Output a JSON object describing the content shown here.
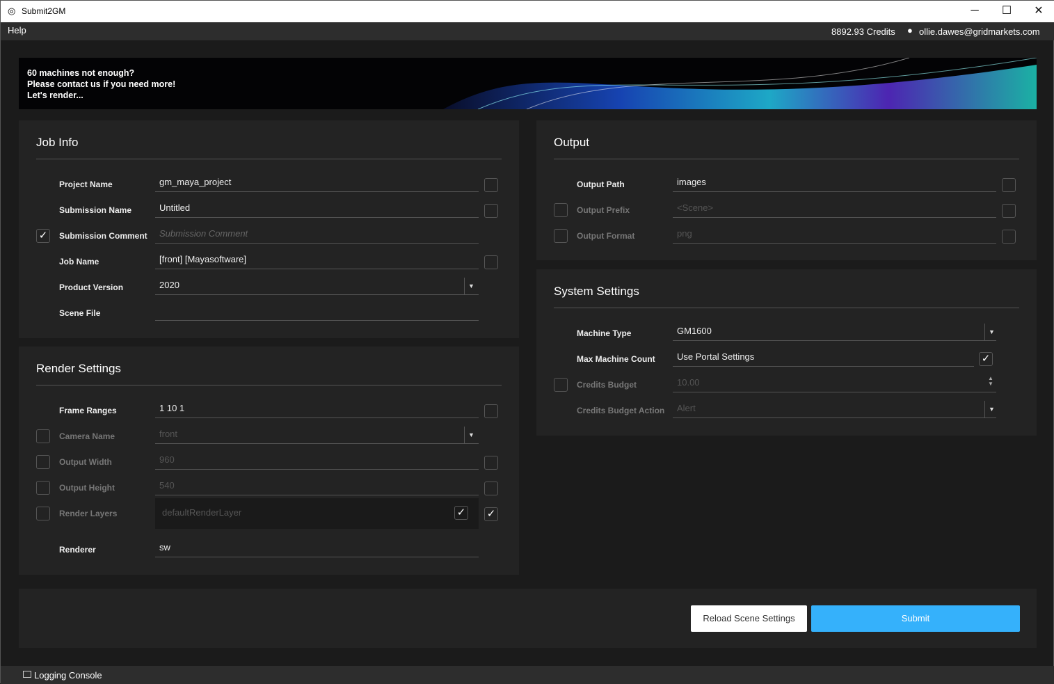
{
  "window": {
    "title": "Submit2GM",
    "minimize": "─",
    "maximize": "☐",
    "close": "✕"
  },
  "menu": {
    "help": "Help",
    "credits": "8892.93 Credits",
    "user": "ollie.dawes@gridmarkets.com"
  },
  "banner": {
    "line1": "60 machines not enough?",
    "line2": "Please contact us if you need more!",
    "line3": "Let's render..."
  },
  "job_info": {
    "title": "Job Info",
    "rows": [
      {
        "label": "Project Name",
        "value": "gm_maya_project",
        "left": null,
        "right": false,
        "type": "text"
      },
      {
        "label": "Submission Name",
        "value": "Untitled",
        "left": null,
        "right": false,
        "type": "text"
      },
      {
        "label": "Submission Comment",
        "value": "Submission Comment",
        "placeholder": true,
        "left": true,
        "right": null,
        "type": "text"
      },
      {
        "label": "Job Name",
        "value": "[front] [Mayasoftware]",
        "left": null,
        "right": false,
        "type": "text"
      },
      {
        "label": "Product Version",
        "value": "2020",
        "left": null,
        "right": null,
        "type": "combo"
      },
      {
        "label": "Scene File",
        "value": "",
        "left": null,
        "right": null,
        "type": "text"
      }
    ]
  },
  "render_settings": {
    "title": "Render Settings",
    "rows": [
      {
        "label": "Frame Ranges",
        "value": "1 10 1",
        "left": null,
        "right": false,
        "type": "text"
      },
      {
        "label": "Camera Name",
        "value": "front",
        "disabled": true,
        "left": false,
        "right": null,
        "type": "combo"
      },
      {
        "label": "Output Width",
        "value": "960",
        "disabled": true,
        "left": false,
        "right": false,
        "type": "text"
      },
      {
        "label": "Output Height",
        "value": "540",
        "disabled": true,
        "left": false,
        "right": false,
        "type": "text"
      },
      {
        "label": "Render Layers",
        "value": "defaultRenderLayer",
        "disabled": true,
        "left": false,
        "right": true,
        "type": "list",
        "item_checked": true
      },
      {
        "label": "Renderer",
        "value": "sw",
        "left": null,
        "right": null,
        "type": "text"
      }
    ]
  },
  "output": {
    "title": "Output",
    "rows": [
      {
        "label": "Output Path",
        "value": "images",
        "left": null,
        "right": false,
        "type": "text"
      },
      {
        "label": "Output Prefix",
        "value": "<Scene>",
        "disabled": true,
        "left": false,
        "right": false,
        "type": "text"
      },
      {
        "label": "Output Format",
        "value": "png",
        "disabled": true,
        "left": false,
        "right": false,
        "type": "text"
      }
    ]
  },
  "system_settings": {
    "title": "System Settings",
    "rows": [
      {
        "label": "Machine Type",
        "value": "GM1600",
        "left": null,
        "right": null,
        "type": "combo"
      },
      {
        "label": "Max Machine Count",
        "value": "Use Portal Settings",
        "left": null,
        "right": null,
        "type": "check",
        "inner_checked": true
      },
      {
        "label": "Credits Budget",
        "value": "10.00",
        "disabled": true,
        "left": false,
        "right": null,
        "type": "spin"
      },
      {
        "label": "Credits Budget Action",
        "value": "Alert",
        "disabled": true,
        "left": null,
        "right": null,
        "type": "combo"
      }
    ]
  },
  "actions": {
    "reload": "Reload Scene Settings",
    "submit": "Submit",
    "accent": "#35b1fb"
  },
  "status": {
    "logging": "Logging Console"
  }
}
